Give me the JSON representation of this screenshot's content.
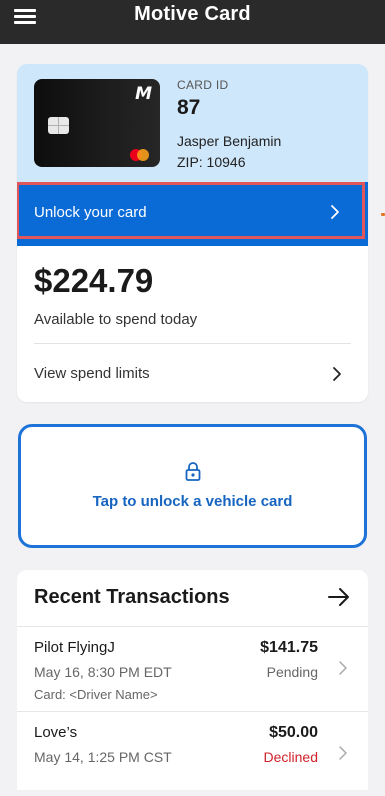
{
  "header": {
    "title": "Motive Card"
  },
  "card": {
    "id_label": "CARD ID",
    "id_value": "87",
    "holder_name": "Jasper Benjamin",
    "zip": "ZIP: 10946",
    "unlock_label": "Unlock your card"
  },
  "balance": {
    "amount": "$224.79",
    "caption": "Available to spend today",
    "spend_limits_label": "View spend limits"
  },
  "vehicle_card": {
    "label": "Tap to unlock a vehicle card"
  },
  "transactions": {
    "title": "Recent Transactions",
    "items": [
      {
        "merchant": "Pilot FlyingJ",
        "amount": "$141.75",
        "date": "May 16, 8:30 PM EDT",
        "status": "Pending",
        "card": "Card: <Driver Name>"
      },
      {
        "merchant": "Love’s",
        "amount": "$50.00",
        "date": "May 14, 1:25 PM CST",
        "status": "Declined",
        "card": ""
      }
    ]
  },
  "colors": {
    "header_bg": "#2a2a2a",
    "card_info_bg": "#cfe7fa",
    "unlock_bg": "#0a6bd7",
    "highlight_border": "#e0565a",
    "vehicle_border": "#1d73d8",
    "declined": "#d0222a"
  },
  "icons": {
    "menu": "hamburger-menu-icon",
    "unlock_row": "chevron-right-icon",
    "vehicle": "lock-icon",
    "transactions_header": "arrow-right-icon"
  }
}
